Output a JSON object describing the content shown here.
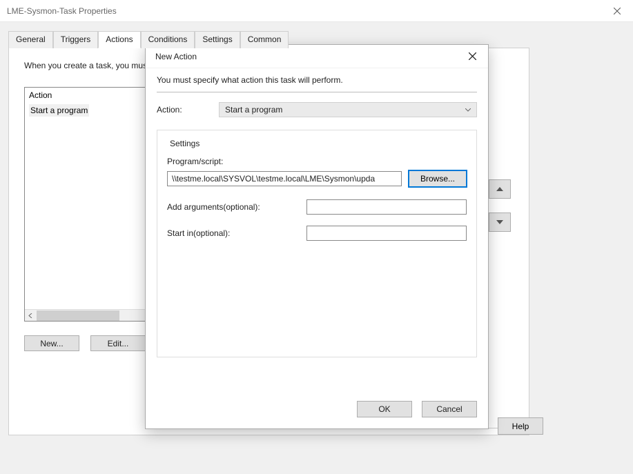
{
  "window": {
    "title": "LME-Sysmon-Task Properties"
  },
  "tabs": {
    "general": "General",
    "triggers": "Triggers",
    "actions": "Actions",
    "conditions": "Conditions",
    "settings": "Settings",
    "common": "Common"
  },
  "actions_panel": {
    "help": "When you create a task, you must specify the action that will occur when your task starts.",
    "column_header": "Action",
    "rows": [
      "Start a program"
    ],
    "buttons": {
      "new": "New...",
      "edit": "Edit..."
    }
  },
  "help_button": "Help",
  "dialog": {
    "title": "New Action",
    "instruction": "You must specify what action this task will perform.",
    "action_label": "Action:",
    "action_value": "Start a program",
    "group_title": "Settings",
    "program_label": "Program/script:",
    "program_value": "\\\\testme.local\\SYSVOL\\testme.local\\LME\\Sysmon\\upda",
    "browse": "Browse...",
    "args_label": "Add arguments(optional):",
    "args_value": "",
    "startin_label": "Start in(optional):",
    "startin_value": "",
    "ok": "OK",
    "cancel": "Cancel"
  }
}
